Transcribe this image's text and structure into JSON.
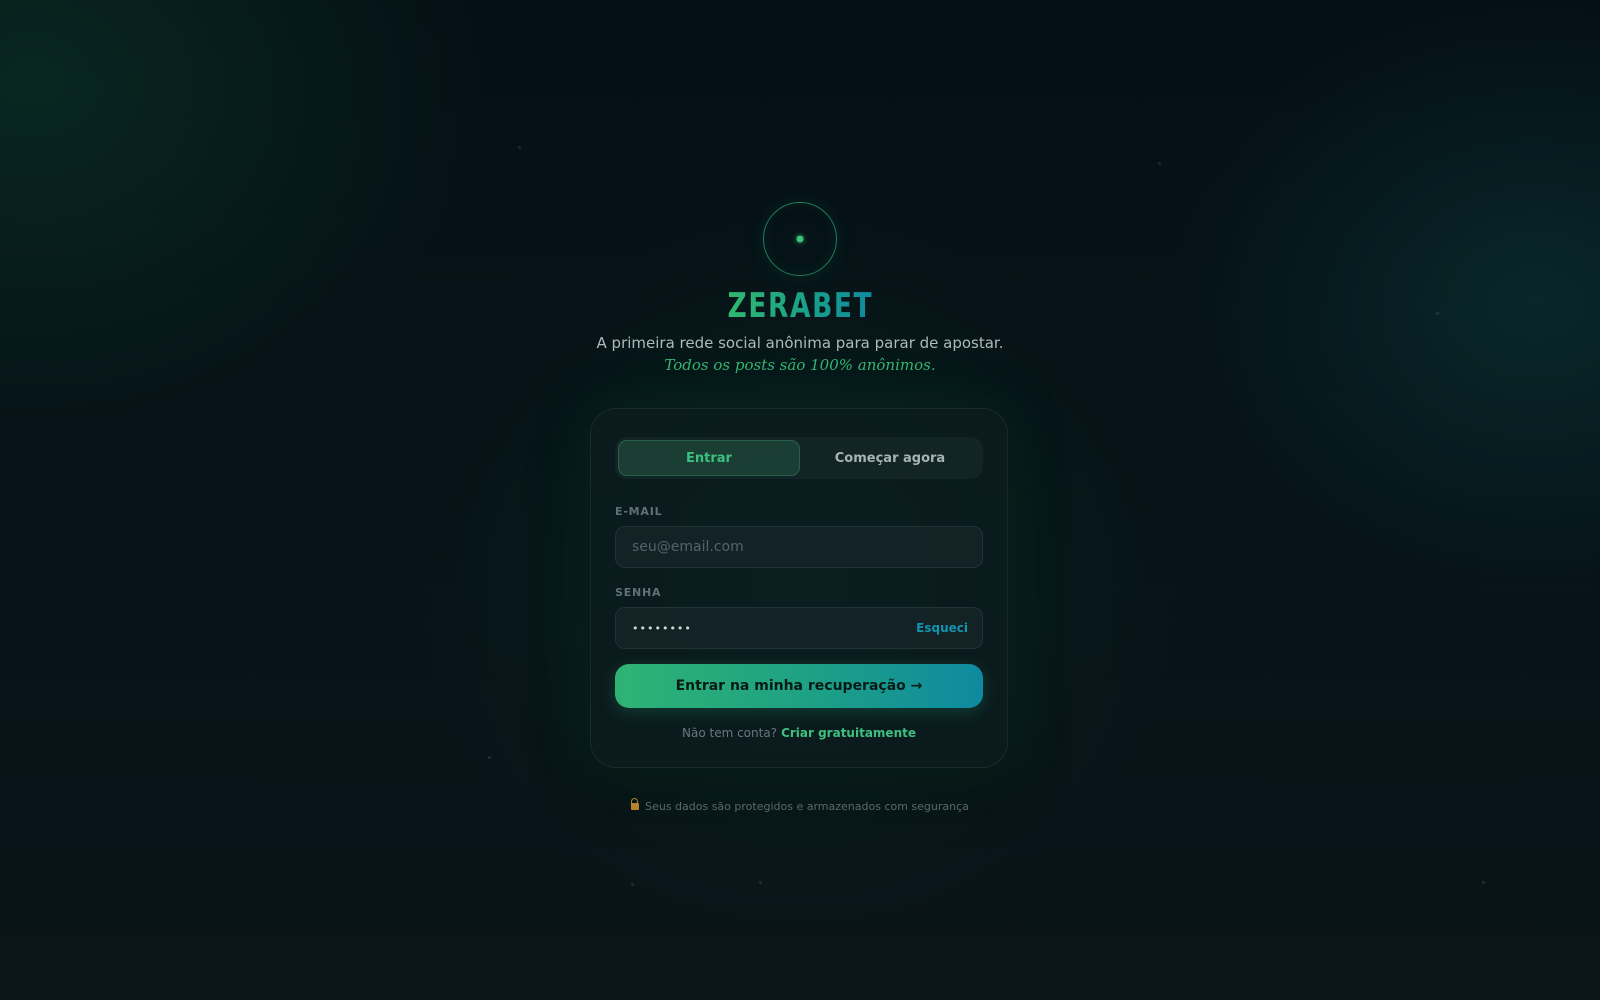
{
  "brand": {
    "logo_icon": "target-dot-icon",
    "title": "ZERABET",
    "subtitle": "A primeira rede social anônima para parar de apostar.",
    "tagline": "Todos os posts são 100% anônimos."
  },
  "auth": {
    "tabs": [
      {
        "label": "Entrar",
        "active": true
      },
      {
        "label": "Começar agora",
        "active": false
      }
    ],
    "email": {
      "label": "E-MAIL",
      "placeholder": "seu@email.com",
      "value": ""
    },
    "password": {
      "label": "SENHA",
      "value": "••••••••",
      "forgot_label": "Esqueci"
    },
    "submit_label": "Entrar na minha recuperação →",
    "signup_prompt": "Não tem conta?",
    "signup_link": "Criar gratuitamente"
  },
  "footer": {
    "security_icon": "lock-icon",
    "security_text": "Seus dados são protegidos e armazenados com segurança"
  },
  "colors": {
    "accent_green": "#35b873",
    "accent_teal": "#0f8aa0",
    "background": "#051116",
    "link_blue": "#1593b0"
  }
}
